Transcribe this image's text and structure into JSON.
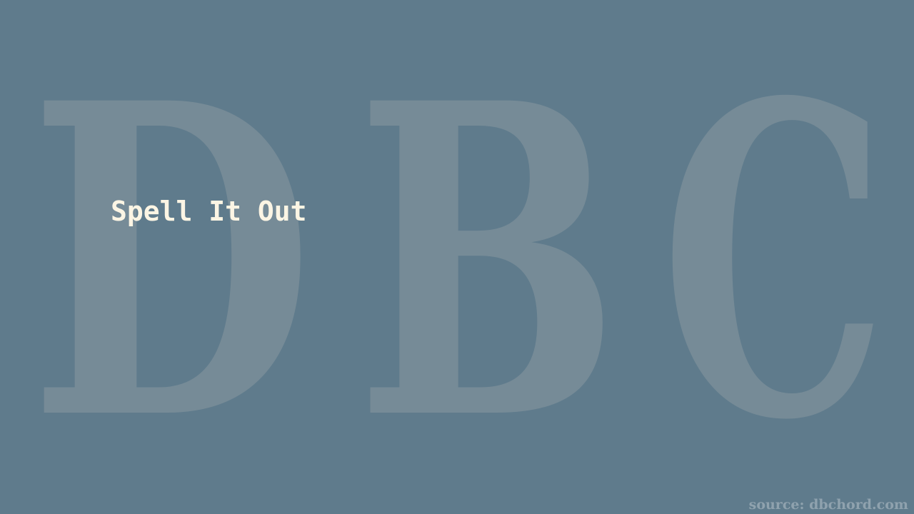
{
  "slide": {
    "backdrop_letters": [
      "D",
      "B",
      "C"
    ],
    "title": "Spell It Out",
    "source_credit": "source: dbchord.com"
  },
  "colors": {
    "background": "#5f7b8c",
    "backdrop_letters": "#768b97",
    "title": "#fcf5e4",
    "source_credit": "#8fa2ae"
  }
}
